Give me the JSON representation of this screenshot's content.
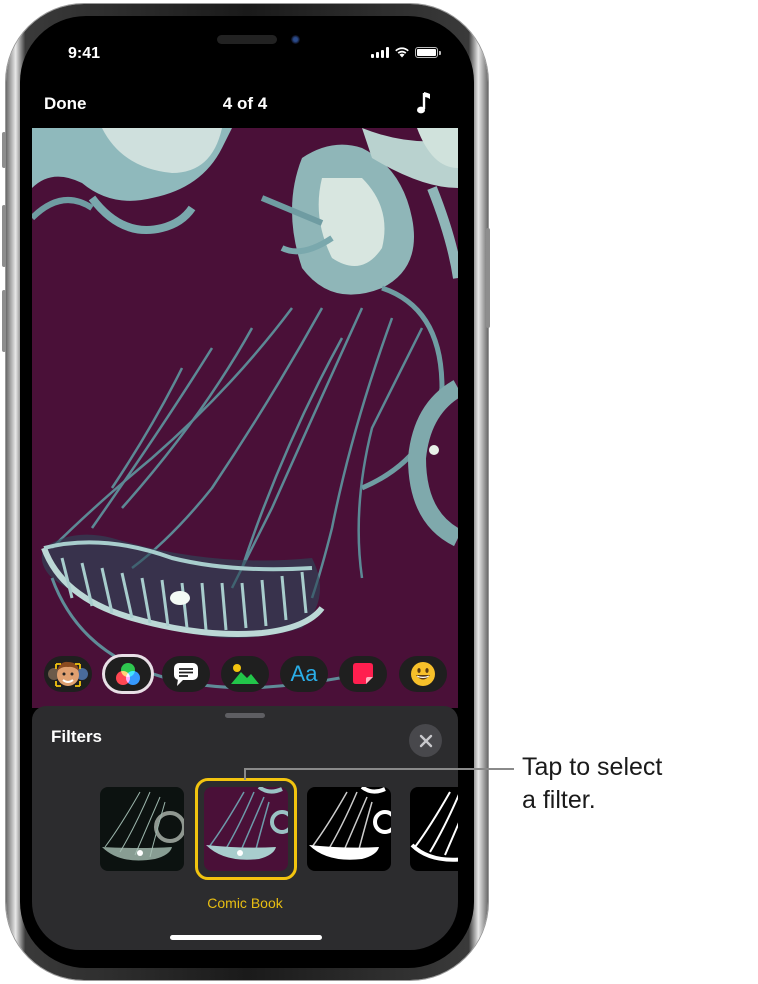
{
  "status_bar": {
    "time": "9:41",
    "signal_icon": "cellular-signal-icon",
    "wifi_icon": "wifi-icon",
    "battery_icon": "battery-full-icon"
  },
  "nav_bar": {
    "done_label": "Done",
    "title": "4 of 4",
    "music_icon": "music-note-icon"
  },
  "photo": {
    "description": "Jellyfish image with Comic Book filter applied",
    "background_color": "#4a1038",
    "accent_color": "#7fb0b6"
  },
  "toolbar": {
    "items": [
      {
        "name": "memoji-camera",
        "icon": "memoji-icon",
        "selected": false
      },
      {
        "name": "filters",
        "icon": "filters-icon",
        "selected": true
      },
      {
        "name": "speech-bubbles",
        "icon": "speech-bubble-icon",
        "selected": false
      },
      {
        "name": "posters",
        "icon": "picture-icon",
        "selected": false
      },
      {
        "name": "text-labels",
        "icon": "text-aa-icon",
        "label": "Aa",
        "selected": false
      },
      {
        "name": "stickers",
        "icon": "sticker-icon",
        "selected": false
      },
      {
        "name": "emoji",
        "icon": "emoji-icon",
        "selected": false
      }
    ]
  },
  "filters_sheet": {
    "title": "Filters",
    "close_icon": "close-icon",
    "filters": [
      {
        "name": "original",
        "selected": false
      },
      {
        "name": "Comic Book",
        "selected": true
      },
      {
        "name": "comic-mono",
        "selected": false
      },
      {
        "name": "ink",
        "selected": false
      }
    ],
    "selected_label": "Comic Book",
    "selection_color": "#f2c40f"
  },
  "callout": {
    "line1": "Tap to select",
    "line2": "a filter."
  }
}
